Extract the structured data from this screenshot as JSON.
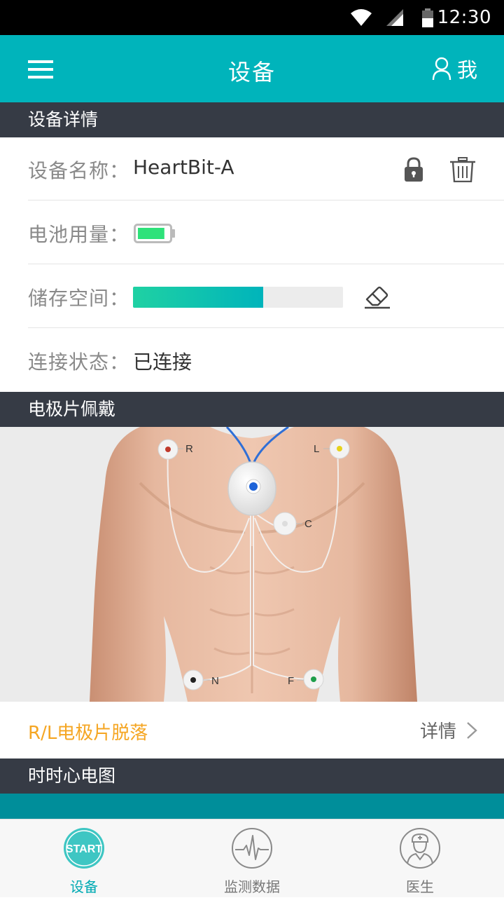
{
  "status_bar": {
    "time": "12:30"
  },
  "app_bar": {
    "title": "设备",
    "profile_label": "我"
  },
  "device_details": {
    "section_title": "设备详情",
    "device_name_label": "设备名称：",
    "device_name_value": "HeartBit-A",
    "battery_label": "电池用量：",
    "battery_level": 0.9,
    "storage_label": "储存空间：",
    "storage_used_fraction": 0.62,
    "connection_label": "连接状态：",
    "connection_value": "已连接"
  },
  "electrode_wearing": {
    "section_title": "电极片佩戴",
    "electrodes": {
      "r": "R",
      "l": "L",
      "c": "C",
      "n": "N",
      "f": "F"
    },
    "alert_text": "R/L电极片脱落",
    "detail_label": "详情"
  },
  "ecg": {
    "section_title": "时时心电图"
  },
  "tab_bar": {
    "tabs": [
      {
        "label": "设备",
        "icon": "start-icon",
        "active": true,
        "icon_text": "START"
      },
      {
        "label": "监测数据",
        "icon": "ecg-wave-icon",
        "active": false
      },
      {
        "label": "医生",
        "icon": "doctor-icon",
        "active": false
      }
    ]
  },
  "colors": {
    "primary": "#00b4bb",
    "section_header": "#363b45",
    "alert": "#f5a623",
    "battery_green": "#2ee27a",
    "storage_fill_start": "#1fd1a3"
  }
}
